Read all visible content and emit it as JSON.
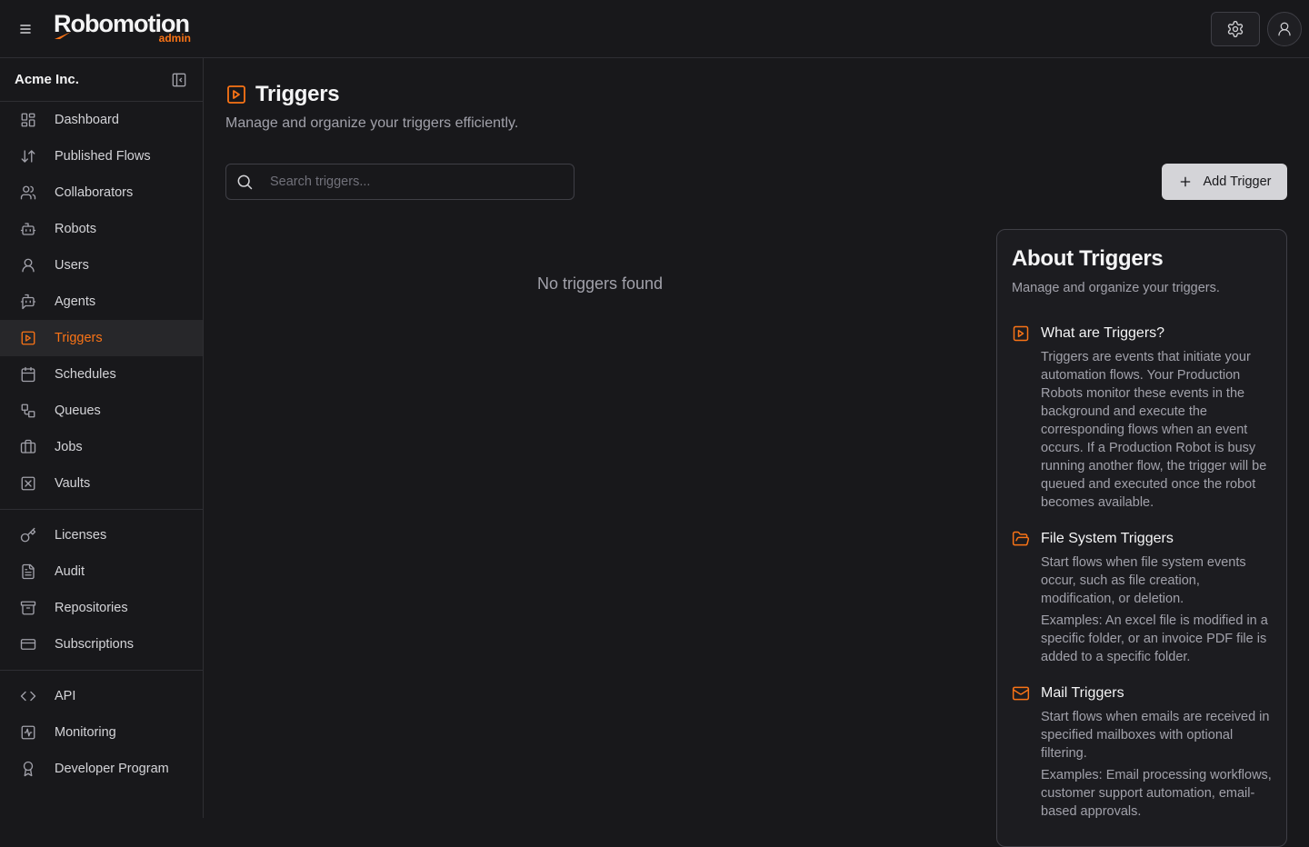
{
  "header": {
    "logo_main": "Robomotion",
    "logo_sub": "admin"
  },
  "sidebar": {
    "org_name": "Acme Inc.",
    "groups": [
      [
        {
          "label": "Dashboard",
          "icon": "dashboard-icon"
        },
        {
          "label": "Published Flows",
          "icon": "arrows-up-down-icon"
        },
        {
          "label": "Collaborators",
          "icon": "users-icon"
        },
        {
          "label": "Robots",
          "icon": "robot-icon"
        },
        {
          "label": "Users",
          "icon": "user-icon"
        },
        {
          "label": "Agents",
          "icon": "agent-icon"
        },
        {
          "label": "Triggers",
          "icon": "play-square-icon",
          "active": true
        },
        {
          "label": "Schedules",
          "icon": "calendar-icon"
        },
        {
          "label": "Queues",
          "icon": "shapes-icon"
        },
        {
          "label": "Jobs",
          "icon": "briefcase-icon"
        },
        {
          "label": "Vaults",
          "icon": "vault-icon"
        }
      ],
      [
        {
          "label": "Licenses",
          "icon": "key-icon"
        },
        {
          "label": "Audit",
          "icon": "file-text-icon"
        },
        {
          "label": "Repositories",
          "icon": "archive-icon"
        },
        {
          "label": "Subscriptions",
          "icon": "credit-card-icon"
        }
      ],
      [
        {
          "label": "API",
          "icon": "code-icon"
        },
        {
          "label": "Monitoring",
          "icon": "activity-icon"
        },
        {
          "label": "Developer Program",
          "icon": "award-icon"
        }
      ]
    ]
  },
  "main": {
    "title": "Triggers",
    "subtitle": "Manage and organize your triggers efficiently.",
    "search_placeholder": "Search triggers...",
    "add_button": "Add Trigger",
    "empty_text": "No triggers found"
  },
  "about": {
    "title": "About Triggers",
    "subtitle": "Manage and organize your triggers.",
    "sections": [
      {
        "icon": "play-square-icon",
        "title": "What are Triggers?",
        "paragraphs": [
          "Triggers are events that initiate your automation flows. Your Production Robots monitor these events in the background and execute the corresponding flows when an event occurs. If a Production Robot is busy running another flow, the trigger will be queued and executed once the robot becomes available."
        ]
      },
      {
        "icon": "folder-open-icon",
        "title": "File System Triggers",
        "paragraphs": [
          "Start flows when file system events occur, such as file creation, modification, or deletion.",
          "Examples: An excel file is modified in a specific folder, or an invoice PDF file is added to a specific folder."
        ]
      },
      {
        "icon": "mail-icon",
        "title": "Mail Triggers",
        "paragraphs": [
          "Start flows when emails are received in specified mailboxes with optional filtering.",
          "Examples: Email processing workflows, customer support automation, email-based approvals."
        ]
      }
    ]
  }
}
